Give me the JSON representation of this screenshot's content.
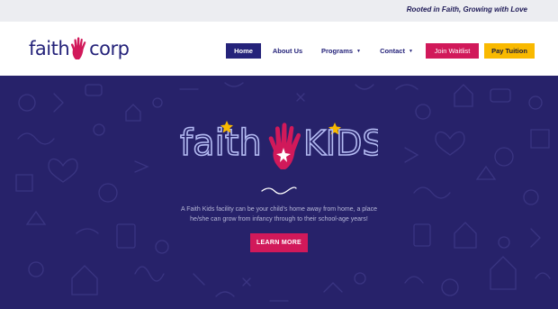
{
  "topbar": {
    "tagline": "Rooted in Faith, Growing with Love"
  },
  "logo": {
    "left_text": "faith",
    "right_text": "corp",
    "hand_color": "#d1195a",
    "text_color": "#25237a"
  },
  "nav": {
    "home": "Home",
    "about": "About Us",
    "programs": "Programs",
    "contact": "Contact",
    "waitlist": "Join Waitlist",
    "tuition": "Pay Tuition",
    "caret_icon": "chevron-down-icon"
  },
  "hero": {
    "background": "#27226a",
    "logo_left_text": "faith",
    "logo_right_text": "KIDS",
    "star_icon": "star-icon",
    "description": "A Faith Kids facility can be your child's home away from home, a place he/she can grow from infancy through to their school-age years!",
    "button": "LEARN MORE"
  },
  "colors": {
    "accent": "#d1195a",
    "navy": "#25237a",
    "gold": "#f9b900"
  }
}
